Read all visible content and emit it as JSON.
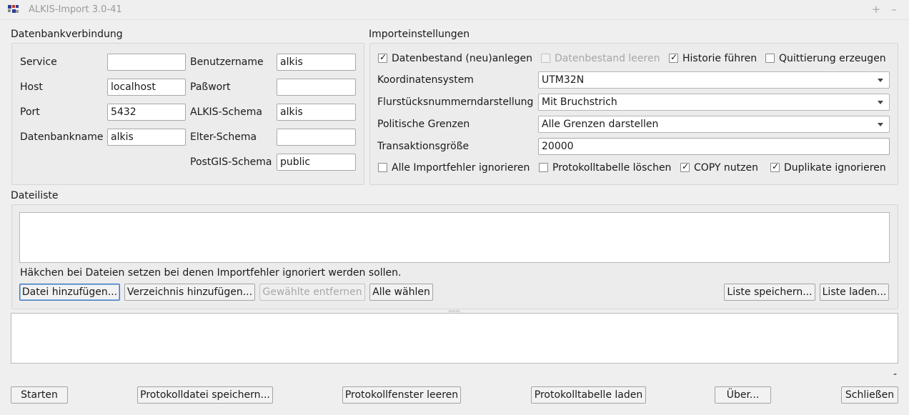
{
  "window": {
    "title": "ALKIS-Import 3.0-41",
    "maximize_glyph": "+",
    "minimize_glyph": "–"
  },
  "db": {
    "group_title": "Datenbankverbindung",
    "service_label": "Service",
    "service_value": "",
    "host_label": "Host",
    "host_value": "localhost",
    "port_label": "Port",
    "port_value": "5432",
    "dbname_label": "Datenbankname",
    "dbname_value": "alkis",
    "user_label": "Benutzername",
    "user_value": "alkis",
    "password_label": "Paßwort",
    "password_value": "",
    "alkis_schema_label": "ALKIS-Schema",
    "alkis_schema_value": "alkis",
    "parent_schema_label": "Elter-Schema",
    "parent_schema_value": "",
    "postgis_schema_label": "PostGIS-Schema",
    "postgis_schema_value": "public"
  },
  "import": {
    "group_title": "Importeinstellungen",
    "checks_top": [
      {
        "label": "Datenbestand (neu)anlegen",
        "checked": true,
        "enabled": true
      },
      {
        "label": "Datenbestand leeren",
        "checked": false,
        "enabled": false
      },
      {
        "label": "Historie führen",
        "checked": true,
        "enabled": true
      },
      {
        "label": "Quittierung erzeugen",
        "checked": false,
        "enabled": true
      }
    ],
    "crs_label": "Koordinatensystem",
    "crs_value": "UTM32N",
    "parcel_label": "Flurstücksnummerndarstellung",
    "parcel_value": "Mit Bruchstrich",
    "borders_label": "Politische Grenzen",
    "borders_value": "Alle Grenzen darstellen",
    "tx_label": "Transaktionsgröße",
    "tx_value": "20000",
    "checks_bottom": [
      {
        "label": "Alle Importfehler ignorieren",
        "checked": false,
        "enabled": true
      },
      {
        "label": "Protokolltabelle löschen",
        "checked": false,
        "enabled": true
      },
      {
        "label": "COPY nutzen",
        "checked": true,
        "enabled": true
      },
      {
        "label": "Duplikate ignorieren",
        "checked": true,
        "enabled": true
      }
    ]
  },
  "files": {
    "group_title": "Dateiliste",
    "hint": "Häkchen bei Dateien setzen bei denen Importfehler ignoriert werden sollen.",
    "add_file": "Datei hinzufügen...",
    "add_dir": "Verzeichnis hinzufügen...",
    "remove_selected": "Gewählte entfernen",
    "select_all": "Alle wählen",
    "save_list": "Liste speichern...",
    "load_list": "Liste laden..."
  },
  "status_text": "-",
  "bottom": {
    "start": "Starten",
    "save_log": "Protokolldatei speichern...",
    "clear_log": "Protokollfenster leeren",
    "load_log_table": "Protokolltabelle laden",
    "about": "Über...",
    "close": "Schließen"
  },
  "colors": {
    "accent": "#3b7bbf",
    "icon_blue": "#2c3e8f",
    "icon_red": "#c0392b"
  }
}
